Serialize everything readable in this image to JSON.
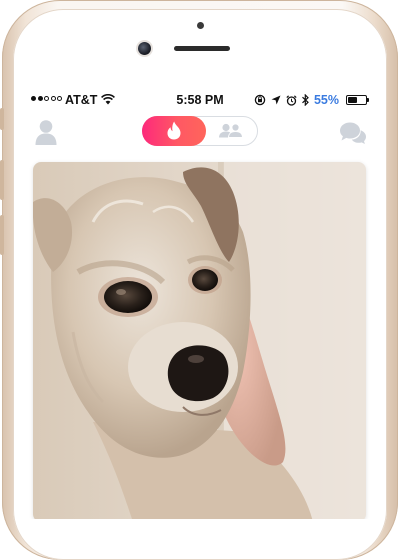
{
  "status_bar": {
    "carrier": "AT&T",
    "time": "5:58 PM",
    "battery_percent": "55%",
    "battery_level": 0.55,
    "signal_bars_filled": 2,
    "signal_bars_total": 5,
    "icons": [
      "wifi-icon",
      "screen-rotation-lock-icon",
      "location-arrow-icon",
      "alarm-icon",
      "bluetooth-icon",
      "battery-icon"
    ]
  },
  "nav": {
    "left_icon": "profile-icon",
    "toggle_active_icon": "flame-icon",
    "toggle_inactive_icon": "group-icon",
    "right_icon": "chat-icon"
  },
  "card": {
    "image": "dog-photo"
  },
  "colors": {
    "brand_gradient_start": "#fd297b",
    "brand_gradient_end": "#ff655b",
    "inactive_icon": "#ced3da",
    "battery_text": "#3a7be0",
    "phone_frame": "#f1e4d7"
  }
}
